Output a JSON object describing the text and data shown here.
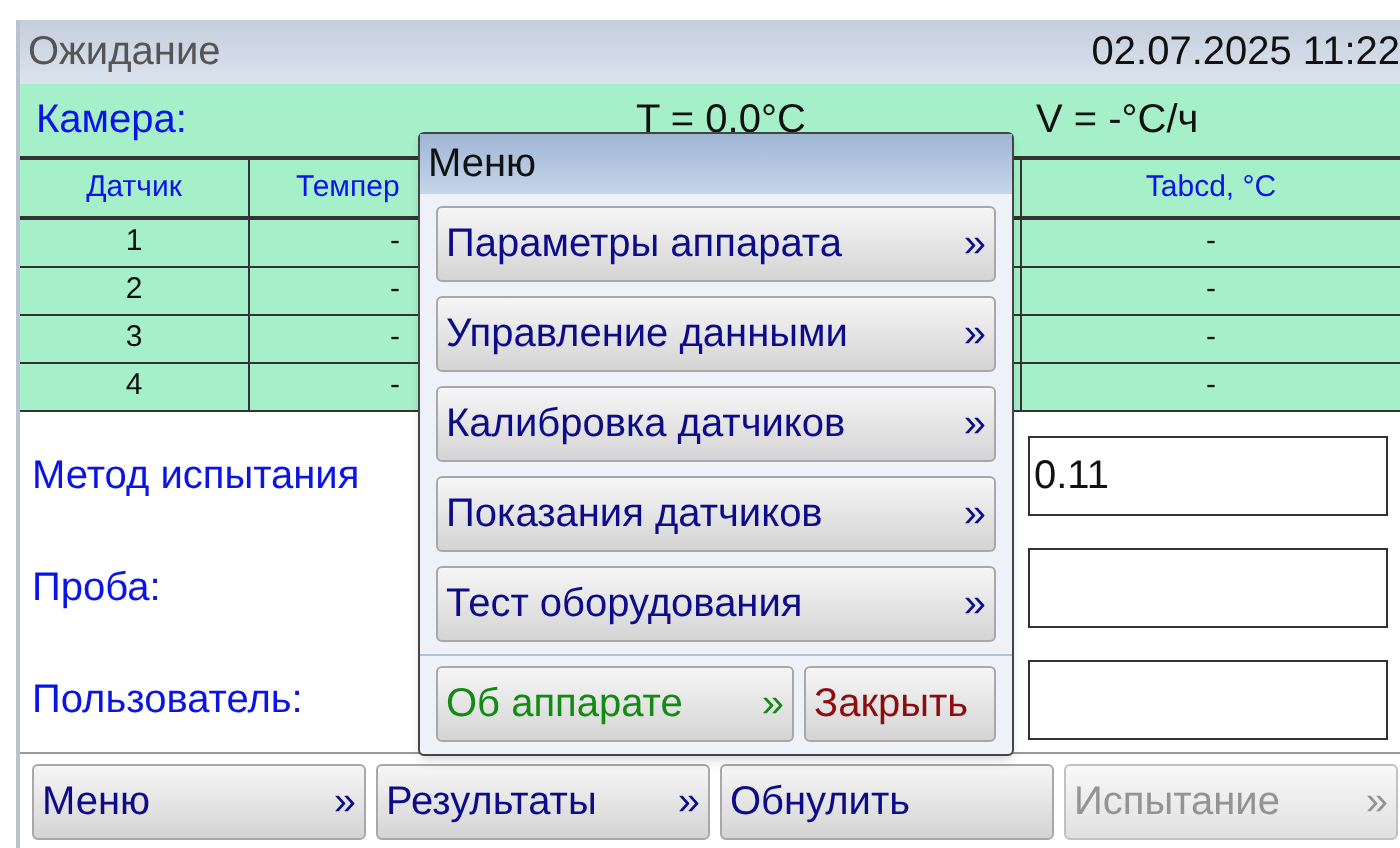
{
  "header": {
    "status": "Ожидание",
    "datetime": "02.07.2025 11:22"
  },
  "chamber": {
    "label": "Камера:",
    "temperature": "T = 0.0°C",
    "rate": "V = -°C/ч"
  },
  "table": {
    "columns": [
      "Датчик",
      "Темпер",
      "Tabcd, °C"
    ],
    "rows": [
      {
        "cells": [
          "1",
          "-",
          "-"
        ]
      },
      {
        "cells": [
          "2",
          "-",
          "-"
        ]
      },
      {
        "cells": [
          "3",
          "-",
          "-"
        ]
      },
      {
        "cells": [
          "4",
          "-",
          "-"
        ]
      }
    ]
  },
  "form": [
    {
      "label": "Метод испытания",
      "value": "0.11"
    },
    {
      "label": "Проба:"
    },
    {
      "label": "Пользователь:"
    }
  ],
  "toolbar": [
    {
      "label": "Меню",
      "arrow": "»",
      "disabled": false
    },
    {
      "label": "Результаты",
      "arrow": "»",
      "disabled": false
    },
    {
      "label": "Обнулить",
      "disabled": false
    },
    {
      "label": "Испытание",
      "arrow": "»",
      "disabled": true
    }
  ],
  "menu": {
    "title": "Меню",
    "items": [
      {
        "label": "Параметры аппарата",
        "arrow": "»"
      },
      {
        "label": "Управление данными",
        "arrow": "»"
      },
      {
        "label": "Калибровка датчиков",
        "arrow": "»"
      },
      {
        "label": "Показания датчиков",
        "arrow": "»"
      },
      {
        "label": "Тест оборудования",
        "arrow": "»"
      }
    ],
    "footer": [
      {
        "label": "Об аппарате",
        "arrow": "»",
        "kind": "about"
      },
      {
        "label": "Закрыть",
        "kind": "close"
      }
    ]
  }
}
